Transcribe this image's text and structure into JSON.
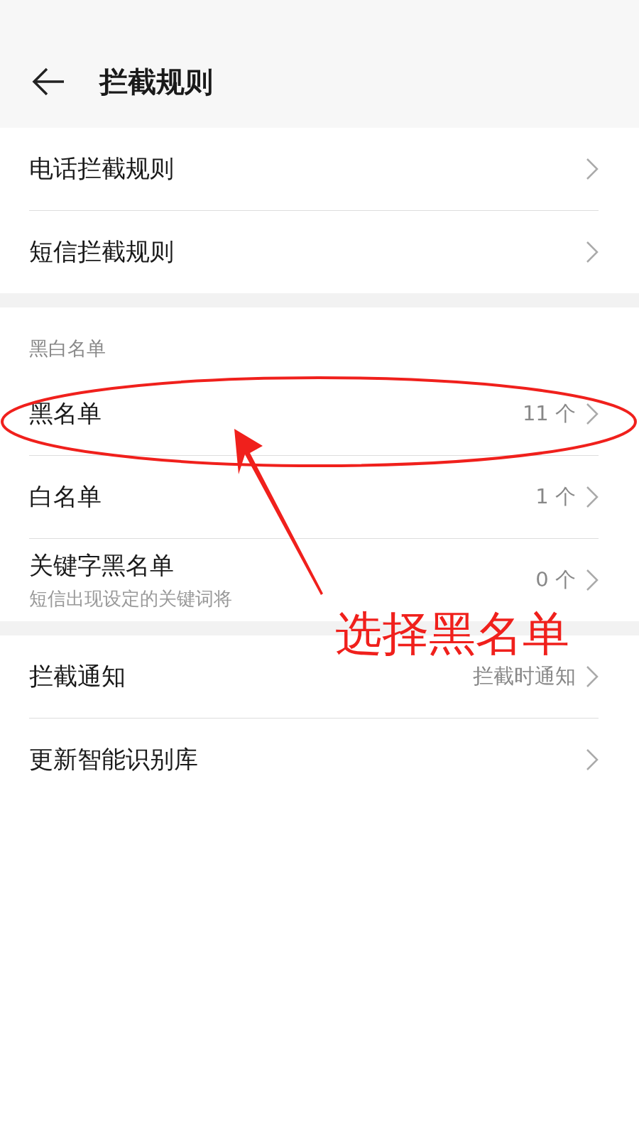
{
  "header": {
    "title": "拦截规则"
  },
  "groups": [
    {
      "items": [
        {
          "label": "电话拦截规则"
        },
        {
          "label": "短信拦截规则"
        }
      ]
    },
    {
      "heading": "黑白名单",
      "items": [
        {
          "label": "黑名单",
          "value": "11 个"
        },
        {
          "label": "白名单",
          "value": "1 个"
        },
        {
          "label": "关键字黑名单",
          "subtitle": "短信出现设定的关键词将",
          "value": "0 个"
        }
      ]
    },
    {
      "items": [
        {
          "label": "拦截通知",
          "value": "拦截时通知"
        },
        {
          "label": "更新智能识别库"
        }
      ]
    }
  ],
  "annotation": {
    "text": "选择黑名单"
  }
}
